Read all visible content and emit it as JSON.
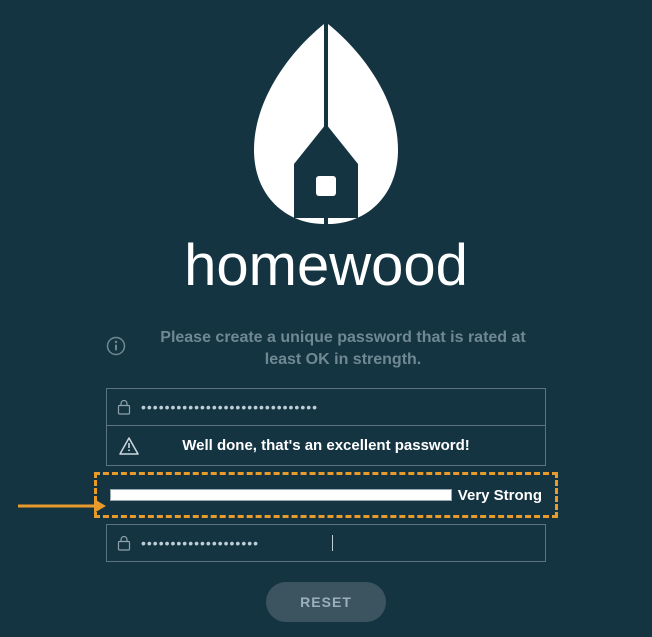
{
  "brand": {
    "name": "homewood"
  },
  "instruction": {
    "text": "Please create a unique password that is rated at least OK in strength."
  },
  "password": {
    "value": "••••••••••••••••••••••••••••••",
    "feedback": "Well done, that's an excellent password!",
    "strength_label": "Very Strong"
  },
  "confirm": {
    "value": "••••••••••••••••••••"
  },
  "actions": {
    "reset_label": "RESET"
  }
}
